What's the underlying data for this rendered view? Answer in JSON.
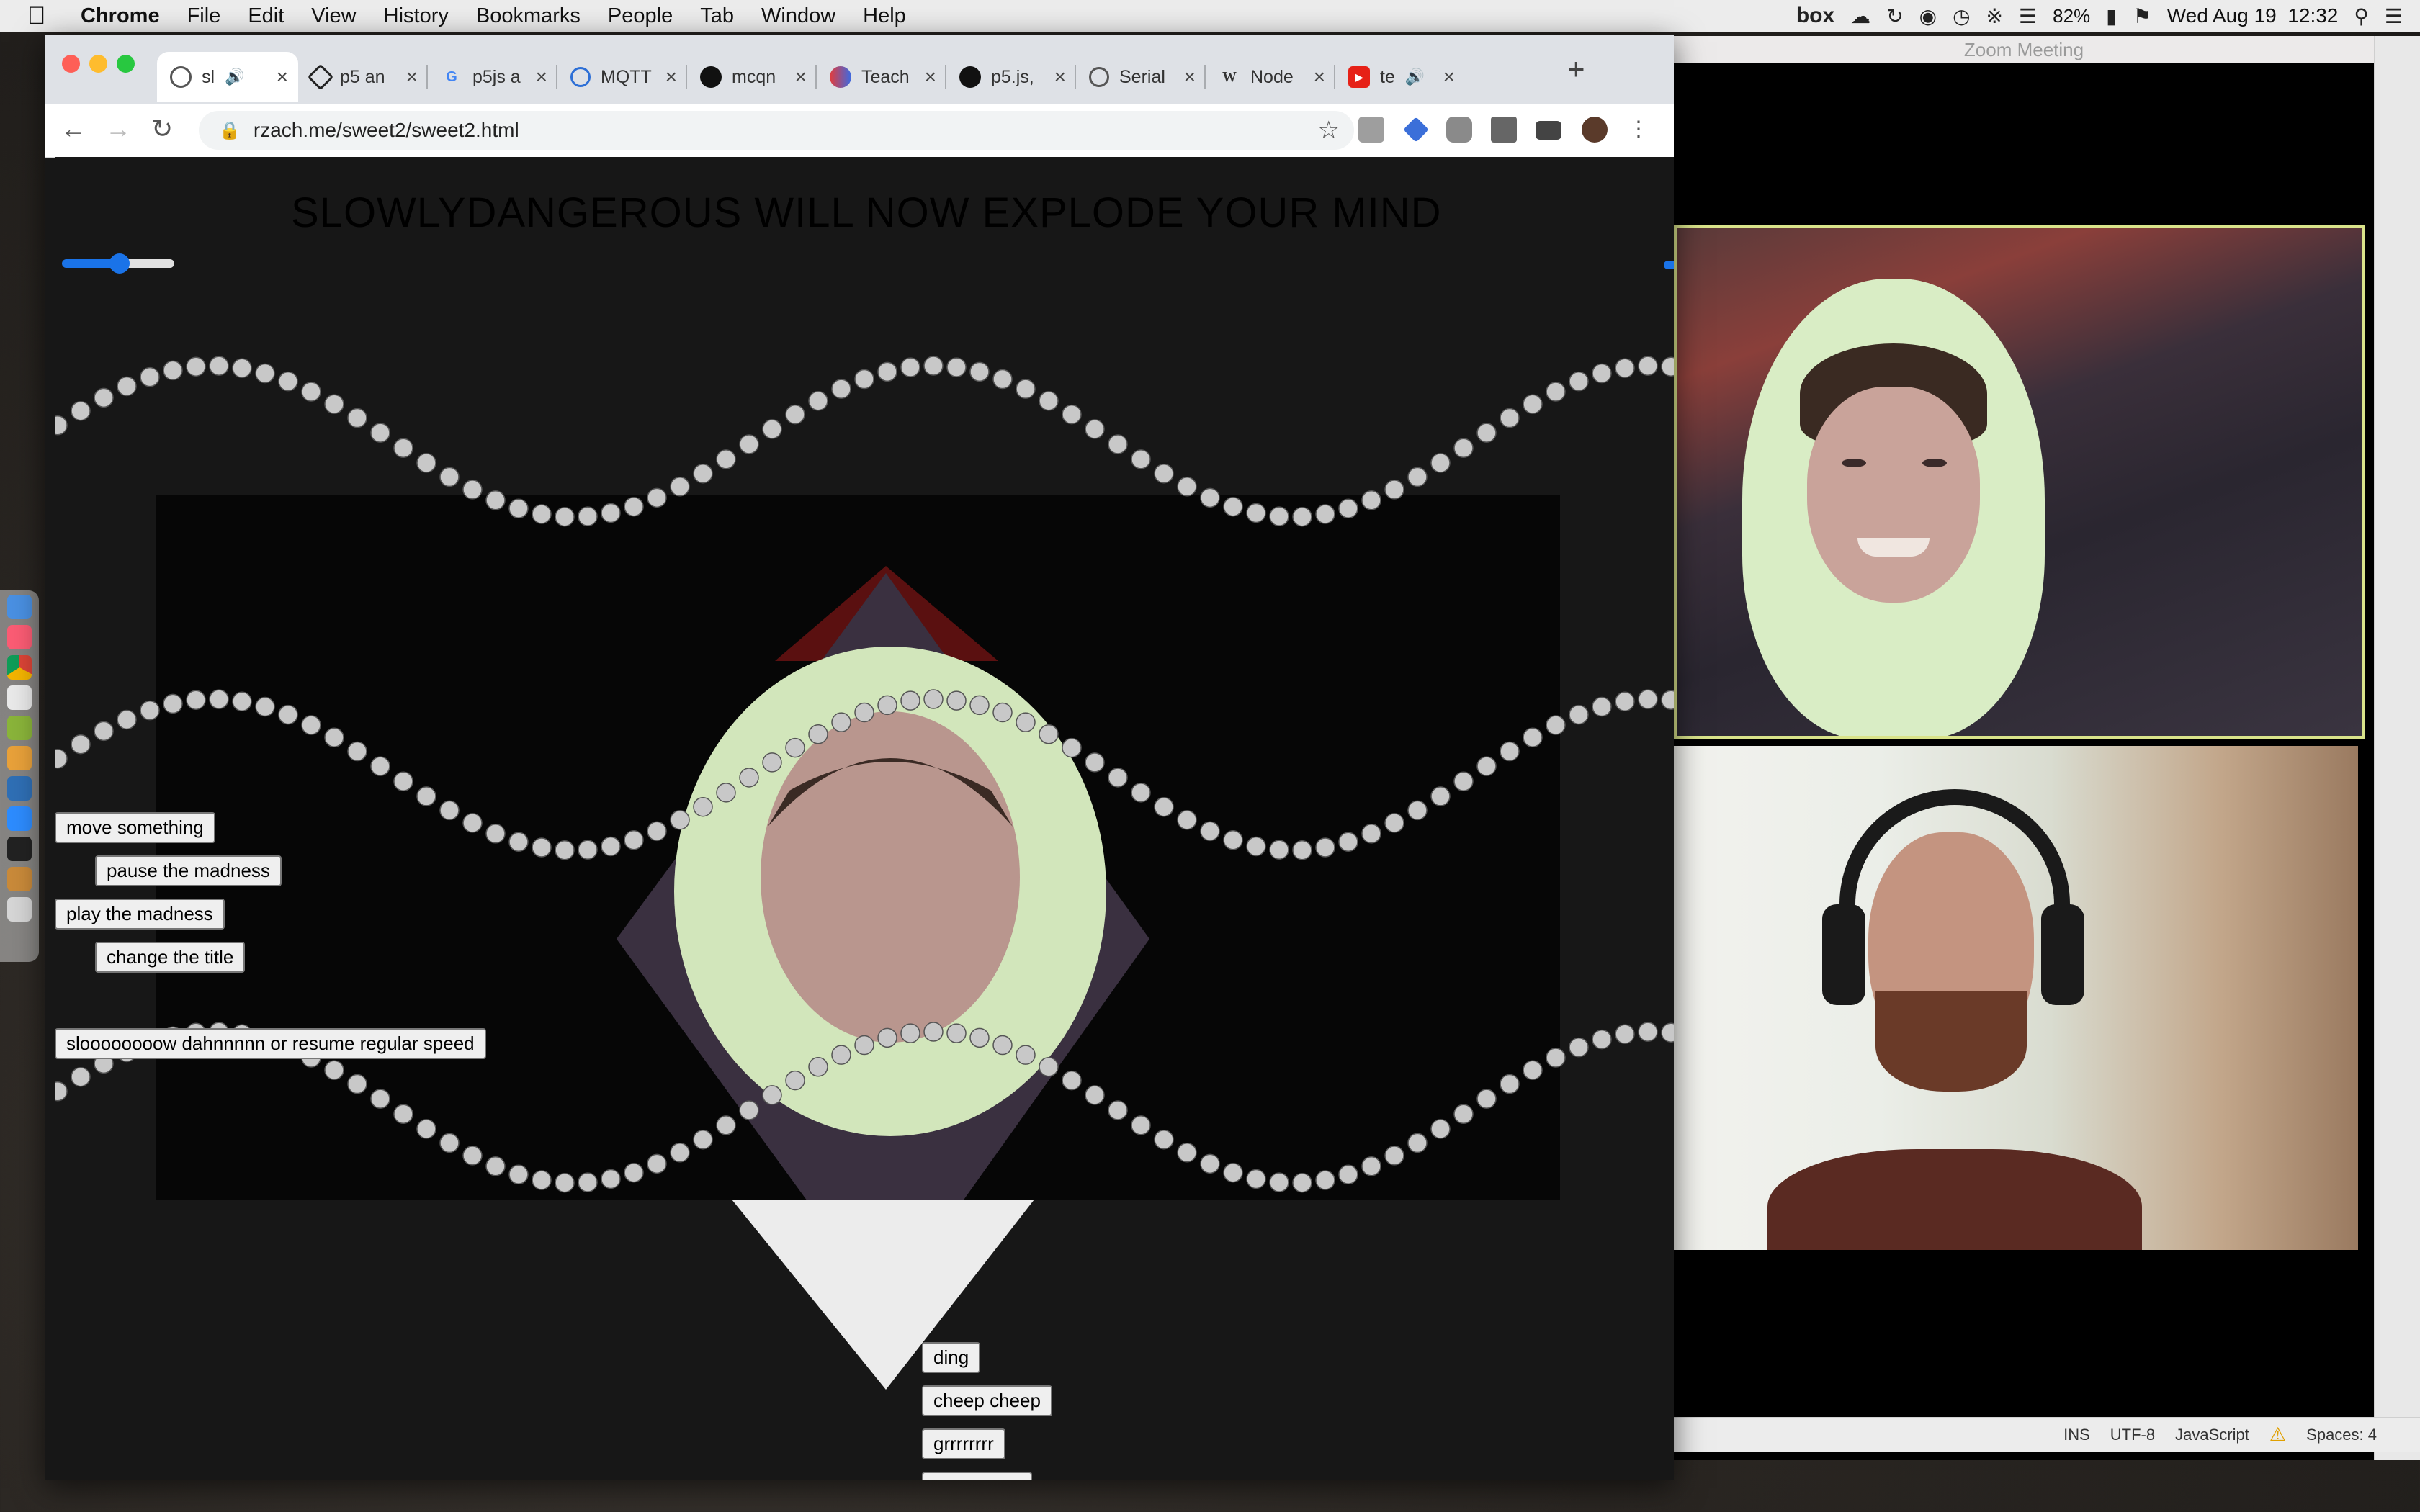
{
  "menubar": {
    "app": "Chrome",
    "items": [
      "File",
      "Edit",
      "View",
      "History",
      "Bookmarks",
      "People",
      "Tab",
      "Window",
      "Help"
    ],
    "box_label": "box",
    "battery": "82%",
    "datetime": "Wed Aug 19  12:32"
  },
  "browser": {
    "tabs": [
      {
        "label": "sl",
        "icon": "globe-icon",
        "active": true
      },
      {
        "label": "p5 an",
        "icon": "codepen-icon"
      },
      {
        "label": "p5js a",
        "icon": "google-icon"
      },
      {
        "label": "MQTT",
        "icon": "mqtt-icon"
      },
      {
        "label": "mcqn",
        "icon": "github-icon"
      },
      {
        "label": "Teach",
        "icon": "teach-icon"
      },
      {
        "label": "p5.js,",
        "icon": "github-icon"
      },
      {
        "label": "Serial",
        "icon": "globe-icon"
      },
      {
        "label": "Node",
        "icon": "wikipedia-icon"
      },
      {
        "label": "te",
        "icon": "youtube-icon"
      }
    ],
    "url": "rzach.me/sweet2/sweet2.html"
  },
  "page": {
    "title": "SLOWLYDANGEROUS WILL NOW EXPLODE YOUR MIND",
    "slider_level": 0.5,
    "buttons": {
      "move": "move something",
      "pause": "pause the madness",
      "play": "play the madness",
      "change_title": "change the title",
      "slow": "sloooooooow dahnnnnn or resume regular speed",
      "ding": "ding",
      "cheep": "cheep cheep",
      "grrr": "grrrrrrrr",
      "dingdong": "ding dong!"
    }
  },
  "zoom": {
    "title": "Zoom Meeting"
  },
  "editor_status": {
    "mode": "INS",
    "encoding": "UTF-8",
    "language": "JavaScript",
    "spaces": "Spaces: 4"
  },
  "colors": {
    "accent": "#1a73e8",
    "speaker_border": "#d9e38a",
    "canvas_bg": "#171717"
  }
}
